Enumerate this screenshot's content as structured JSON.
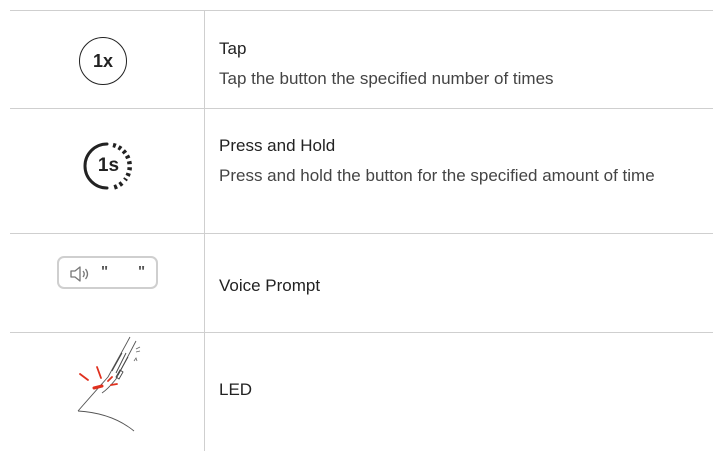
{
  "rows": [
    {
      "icon_name": "tap-1x-icon",
      "icon_text": "1x",
      "title": "Tap",
      "description": "Tap the button the specified number of times"
    },
    {
      "icon_name": "press-hold-1s-icon",
      "icon_text": "1s",
      "title": "Press and Hold",
      "description": "Press and hold the button for the specified amount of time"
    },
    {
      "icon_name": "voice-prompt-icon",
      "icon_text_left": "\"",
      "icon_text_right": "\"",
      "title": "Voice Prompt"
    },
    {
      "icon_name": "led-icon",
      "title": "LED"
    }
  ],
  "colors": {
    "divider": "#cfcfcf",
    "text": "#2a2a2a",
    "led_red": "#e0301e",
    "icon_dark": "#222222"
  }
}
